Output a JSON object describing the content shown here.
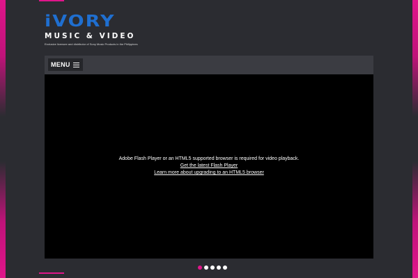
{
  "logo": {
    "word": "iVORY",
    "subtitle": "MUSIC & VIDEO",
    "tagline": "Exclusive licensee and distributor of Sony Music Products in the Philippines"
  },
  "nav": {
    "menu_label": "MENU"
  },
  "player": {
    "message": "Adobe Flash Player or an HTML5 supported browser is required for video playback.",
    "link_flash": "Get the latest Flash Player",
    "link_html5": "Learn more about upgrading to an HTML5 browser"
  },
  "slider": {
    "dot_count": 5,
    "active_index": 0
  },
  "colors": {
    "accent": "#e0158a",
    "logo_blue": "#1f6fd0",
    "background": "#2b2c31",
    "navbar": "#3b3c42"
  }
}
